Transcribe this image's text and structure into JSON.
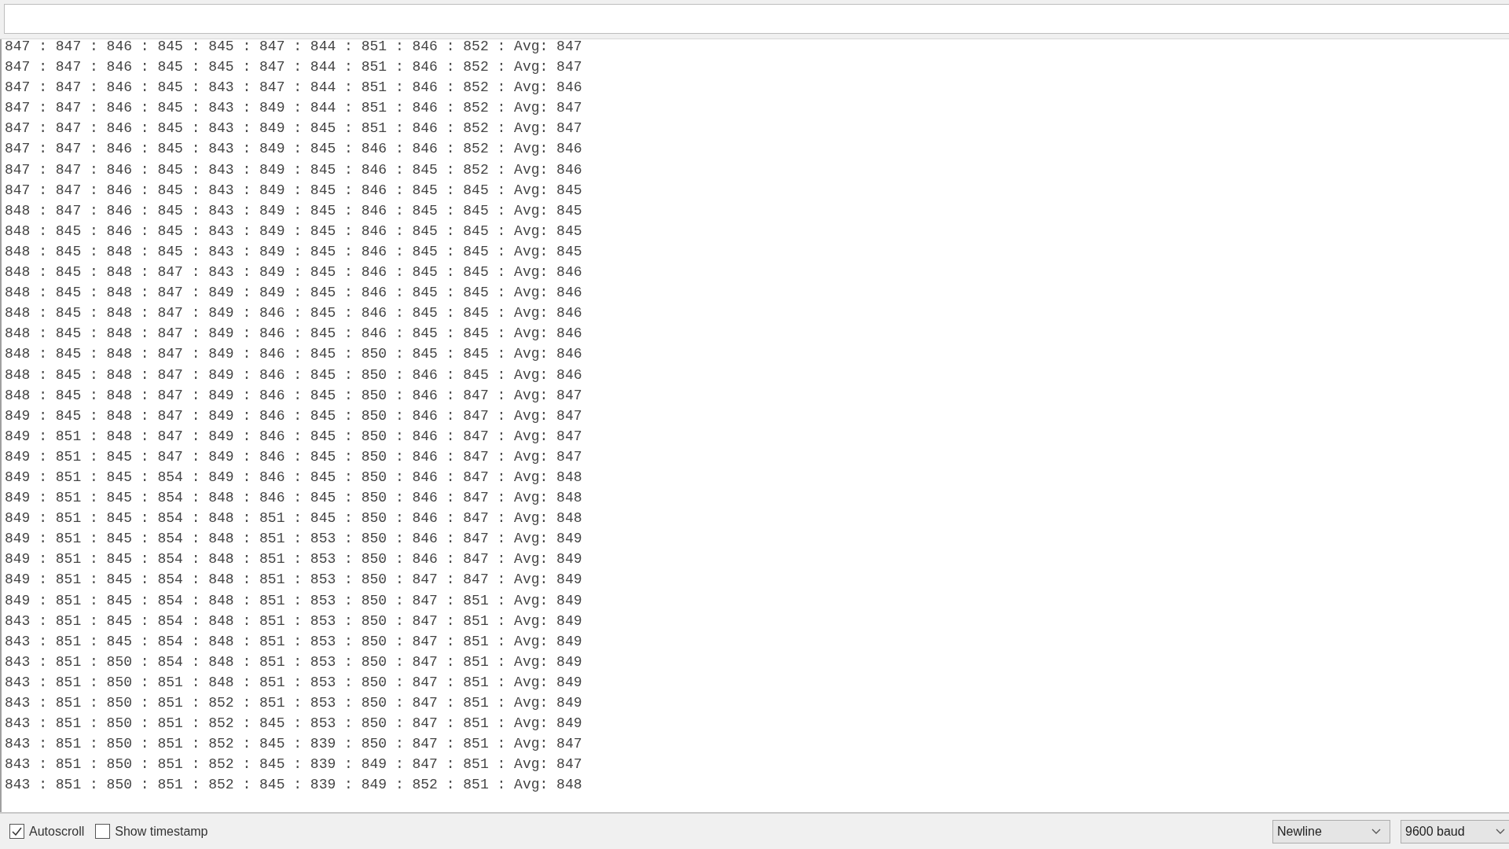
{
  "output_lines": [
    "847 : 847 : 846 : 845 : 845 : 847 : 844 : 851 : 846 : 852 : Avg: 847",
    "847 : 847 : 846 : 845 : 845 : 847 : 844 : 851 : 846 : 852 : Avg: 847",
    "847 : 847 : 846 : 845 : 843 : 847 : 844 : 851 : 846 : 852 : Avg: 846",
    "847 : 847 : 846 : 845 : 843 : 849 : 844 : 851 : 846 : 852 : Avg: 847",
    "847 : 847 : 846 : 845 : 843 : 849 : 845 : 851 : 846 : 852 : Avg: 847",
    "847 : 847 : 846 : 845 : 843 : 849 : 845 : 846 : 846 : 852 : Avg: 846",
    "847 : 847 : 846 : 845 : 843 : 849 : 845 : 846 : 845 : 852 : Avg: 846",
    "847 : 847 : 846 : 845 : 843 : 849 : 845 : 846 : 845 : 845 : Avg: 845",
    "848 : 847 : 846 : 845 : 843 : 849 : 845 : 846 : 845 : 845 : Avg: 845",
    "848 : 845 : 846 : 845 : 843 : 849 : 845 : 846 : 845 : 845 : Avg: 845",
    "848 : 845 : 848 : 845 : 843 : 849 : 845 : 846 : 845 : 845 : Avg: 845",
    "848 : 845 : 848 : 847 : 843 : 849 : 845 : 846 : 845 : 845 : Avg: 846",
    "848 : 845 : 848 : 847 : 849 : 849 : 845 : 846 : 845 : 845 : Avg: 846",
    "848 : 845 : 848 : 847 : 849 : 846 : 845 : 846 : 845 : 845 : Avg: 846",
    "848 : 845 : 848 : 847 : 849 : 846 : 845 : 846 : 845 : 845 : Avg: 846",
    "848 : 845 : 848 : 847 : 849 : 846 : 845 : 850 : 845 : 845 : Avg: 846",
    "848 : 845 : 848 : 847 : 849 : 846 : 845 : 850 : 846 : 845 : Avg: 846",
    "848 : 845 : 848 : 847 : 849 : 846 : 845 : 850 : 846 : 847 : Avg: 847",
    "849 : 845 : 848 : 847 : 849 : 846 : 845 : 850 : 846 : 847 : Avg: 847",
    "849 : 851 : 848 : 847 : 849 : 846 : 845 : 850 : 846 : 847 : Avg: 847",
    "849 : 851 : 845 : 847 : 849 : 846 : 845 : 850 : 846 : 847 : Avg: 847",
    "849 : 851 : 845 : 854 : 849 : 846 : 845 : 850 : 846 : 847 : Avg: 848",
    "849 : 851 : 845 : 854 : 848 : 846 : 845 : 850 : 846 : 847 : Avg: 848",
    "849 : 851 : 845 : 854 : 848 : 851 : 845 : 850 : 846 : 847 : Avg: 848",
    "849 : 851 : 845 : 854 : 848 : 851 : 853 : 850 : 846 : 847 : Avg: 849",
    "849 : 851 : 845 : 854 : 848 : 851 : 853 : 850 : 846 : 847 : Avg: 849",
    "849 : 851 : 845 : 854 : 848 : 851 : 853 : 850 : 847 : 847 : Avg: 849",
    "849 : 851 : 845 : 854 : 848 : 851 : 853 : 850 : 847 : 851 : Avg: 849",
    "843 : 851 : 845 : 854 : 848 : 851 : 853 : 850 : 847 : 851 : Avg: 849",
    "843 : 851 : 845 : 854 : 848 : 851 : 853 : 850 : 847 : 851 : Avg: 849",
    "843 : 851 : 850 : 854 : 848 : 851 : 853 : 850 : 847 : 851 : Avg: 849",
    "843 : 851 : 850 : 851 : 848 : 851 : 853 : 850 : 847 : 851 : Avg: 849",
    "843 : 851 : 850 : 851 : 852 : 851 : 853 : 850 : 847 : 851 : Avg: 849",
    "843 : 851 : 850 : 851 : 852 : 845 : 853 : 850 : 847 : 851 : Avg: 849",
    "843 : 851 : 850 : 851 : 852 : 845 : 839 : 850 : 847 : 851 : Avg: 847",
    "843 : 851 : 850 : 851 : 852 : 845 : 839 : 849 : 847 : 851 : Avg: 847",
    "843 : 851 : 850 : 851 : 852 : 845 : 839 : 849 : 852 : 851 : Avg: 848"
  ],
  "status_bar": {
    "autoscroll": {
      "label": "Autoscroll",
      "checked": true
    },
    "show_timestamp": {
      "label": "Show timestamp",
      "checked": false
    },
    "line_ending": {
      "value": "Newline"
    },
    "baud_rate": {
      "value": "9600 baud"
    }
  }
}
